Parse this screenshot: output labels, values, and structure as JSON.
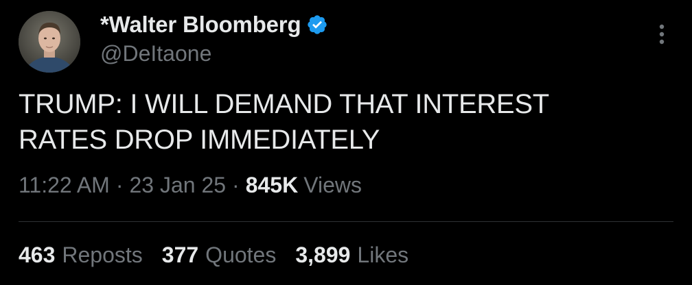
{
  "author": {
    "display_name": "*Walter Bloomberg",
    "handle": "@DeItaone",
    "verified": true,
    "verified_color": "#1d9bf0"
  },
  "tweet": {
    "text_lines": [
      "TRUMP: I WILL DEMAND THAT INTEREST",
      "RATES DROP IMMEDIATELY"
    ]
  },
  "meta": {
    "time": "11:22 AM",
    "separator": "·",
    "date": "23 Jan 25",
    "views_count": "845K",
    "views_label": "Views"
  },
  "stats": {
    "reposts_count": "463",
    "reposts_label": "Reposts",
    "quotes_count": "377",
    "quotes_label": "Quotes",
    "likes_count": "3,899",
    "likes_label": "Likes"
  },
  "icons": {
    "verified": "verified-badge-icon",
    "more": "more-options-icon"
  },
  "colors": {
    "background": "#000000",
    "primary_text": "#e7e9ea",
    "secondary_text": "#71767b",
    "divider": "#2f3336"
  }
}
